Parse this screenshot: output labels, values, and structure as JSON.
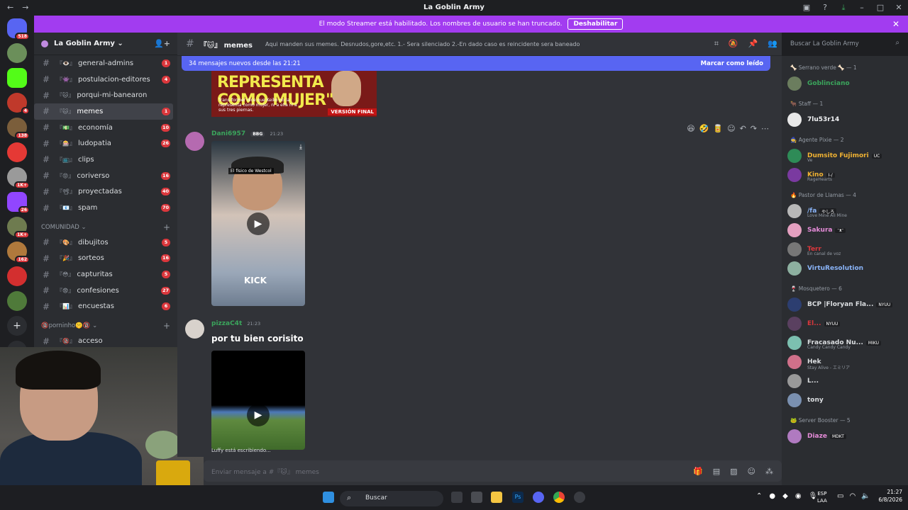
{
  "window": {
    "title": "La Goblin Army",
    "back": "←",
    "forward": "→"
  },
  "banner": {
    "text": "El modo Streamer está habilitado. Los nombres de usuario se han truncado.",
    "button": "Deshabilitar",
    "close": "✕"
  },
  "rail": {
    "badges": [
      "518",
      "",
      "",
      "4",
      "138",
      "",
      "1K+",
      "26",
      "1K+",
      "162",
      "",
      ""
    ]
  },
  "guild": {
    "name": "La Goblin Army ⌄"
  },
  "channels": [
    {
      "emoji": "『👁️』",
      "name": "general-admins",
      "count": "1"
    },
    {
      "emoji": "『👾』",
      "name": "postulacion-editores",
      "count": "4"
    },
    {
      "emoji": "『🐱』",
      "name": "porqui-mi-banearon",
      "count": ""
    },
    {
      "emoji": "『🐱』",
      "name": "memes",
      "count": "1"
    },
    {
      "emoji": "『💵』",
      "name": "economía",
      "count": "10"
    },
    {
      "emoji": "『🎰』",
      "name": "ludopatia",
      "count": "26"
    },
    {
      "emoji": "『📺』",
      "name": "clips",
      "count": ""
    },
    {
      "emoji": "『😡』",
      "name": "coriverso",
      "count": "16"
    },
    {
      "emoji": "『📽』",
      "name": "proyectadas",
      "count": "40"
    },
    {
      "emoji": "『📧』",
      "name": "spam",
      "count": "70"
    }
  ],
  "category_comunidad": {
    "label": "COMUNIDAD ⌄",
    "plus": "+"
  },
  "channels_comunidad": [
    {
      "emoji": "『🎨』",
      "name": "dibujitos",
      "count": "5"
    },
    {
      "emoji": "『🎉』",
      "name": "sorteos",
      "count": "16"
    },
    {
      "emoji": "『😳』",
      "name": "capturitas",
      "count": "5"
    },
    {
      "emoji": "『😨』",
      "name": "confesiones",
      "count": "27"
    },
    {
      "emoji": "『📊』",
      "name": "encuestas",
      "count": "6"
    }
  ],
  "category_porno": {
    "label": "🔞porninho🤫🔞 ⌄",
    "plus": "+"
  },
  "channels_porno": [
    {
      "emoji": "『🔞』",
      "name": "acceso",
      "count": ""
    }
  ],
  "topbar": {
    "channel": "『🐱』 memes",
    "topic": "Aqui manden sus memes. Desnudos,gore,etc. 1.- Sera silenciado 2.-En dado caso es reincidente sera baneado",
    "search_placeholder": "Buscar La Goblin Army"
  },
  "newbar": {
    "text": "34 mensajes nuevos desde las 21:21",
    "mark": "Marcar como leído"
  },
  "img1": {
    "headline": "REPRESENTA COMO MUJER\"",
    "sub": "Trans-former dice que Keiko no la representa como mujer, ni a ella ni a sus tres piernas.",
    "tag": "VERSIÓN FINAL"
  },
  "messages": [
    {
      "author": "Dani6957",
      "tag": "BBG",
      "time": "21:23",
      "video_label": "El físico de Westcol",
      "video_caption": "KICK"
    },
    {
      "author": "pizzaC4t",
      "tag": "",
      "time": "21:23",
      "text": "por tu bien corisito"
    }
  ],
  "typing": "Luffy está escribiendo...",
  "composer": {
    "placeholder": "Enviar mensaje a #『🐱』 memes"
  },
  "members": {
    "groups": [
      {
        "label": "🦴 Serrano verde 🦴 — 1",
        "members": [
          {
            "name": "Goblinciano",
            "color": "#3ba55c",
            "status": ""
          }
        ]
      },
      {
        "label": "🐂 Staff — 1",
        "members": [
          {
            "name": "7lu53r14",
            "color": "#f2f3f5",
            "status": "",
            "tag": ""
          }
        ]
      },
      {
        "label": "🧙 Agente Pixie — 2",
        "members": [
          {
            "name": "Dumsito Fujimori",
            "color": "#f0b232",
            "status": "Ve",
            "tag": "UC"
          },
          {
            "name": "Kino",
            "color": "#f0b232",
            "status": "RageHearts",
            "tag": "I-/"
          }
        ]
      },
      {
        "label": "🔥 Pastor de Llamas — 4",
        "members": [
          {
            "name": "/fa",
            "color": "#8ab4f8",
            "status": "Love Mine All Mine",
            "tag": "やしろ"
          },
          {
            "name": "Sakura",
            "color": "#e58bd8",
            "status": "",
            "tag": "ᵔᴥᵔ"
          },
          {
            "name": "Terr",
            "color": "#da373c",
            "status": "En canal de voz",
            "tag": ""
          },
          {
            "name": "VirtuResolution",
            "color": "#8ab4f8",
            "status": "",
            "tag": ""
          }
        ]
      },
      {
        "label": "🍷 Mosquetero — 6",
        "members": [
          {
            "name": "BCP |Floryan Fla...",
            "color": "#dbdee1",
            "status": "",
            "tag": "NYUU"
          },
          {
            "name": "El...",
            "color": "#da373c",
            "status": "",
            "tag": "NYUU"
          },
          {
            "name": "Fracasado Nu...",
            "color": "#dbdee1",
            "status": "Candy Candy Candy",
            "tag": "MIKU"
          },
          {
            "name": "Hek",
            "color": "#dbdee1",
            "status": "Stay Alive - エミリア",
            "tag": ""
          },
          {
            "name": "L...",
            "color": "#dbdee1",
            "status": "",
            "tag": ""
          },
          {
            "name": "tony",
            "color": "#dbdee1",
            "status": "",
            "tag": ""
          }
        ]
      },
      {
        "label": "🐸 Server Booster — 5",
        "members": [
          {
            "name": "Diaze",
            "color": "#e58bd8",
            "status": "",
            "tag": "MDKT"
          }
        ]
      }
    ]
  },
  "taskbar": {
    "search": "Buscar",
    "lang_top": "ESP",
    "lang_bottom": "LAA",
    "time": "21:27",
    "date": "6/8/2026"
  },
  "colors": {
    "accent": "#5865f2",
    "banner": "#a23cf0",
    "badge": "#da373c"
  }
}
